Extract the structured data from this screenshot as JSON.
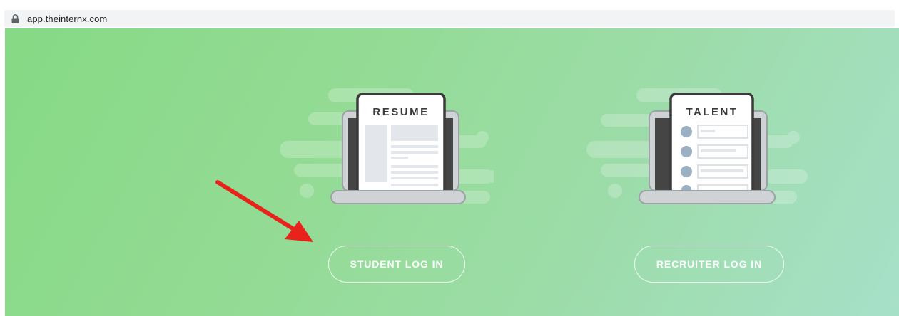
{
  "browser": {
    "url": "app.theinternx.com",
    "lock_icon": "lock-icon"
  },
  "hero": {
    "background_colors": [
      "#86d985",
      "#a7e0c8"
    ],
    "student": {
      "card_title": "RESUME",
      "button_label": "STUDENT LOG IN"
    },
    "recruiter": {
      "card_title": "TALENT",
      "button_label": "RECRUITER LOG IN"
    },
    "annotation": {
      "arrow_color": "#e8231c",
      "arrow_icon": "red-arrow-icon"
    }
  }
}
